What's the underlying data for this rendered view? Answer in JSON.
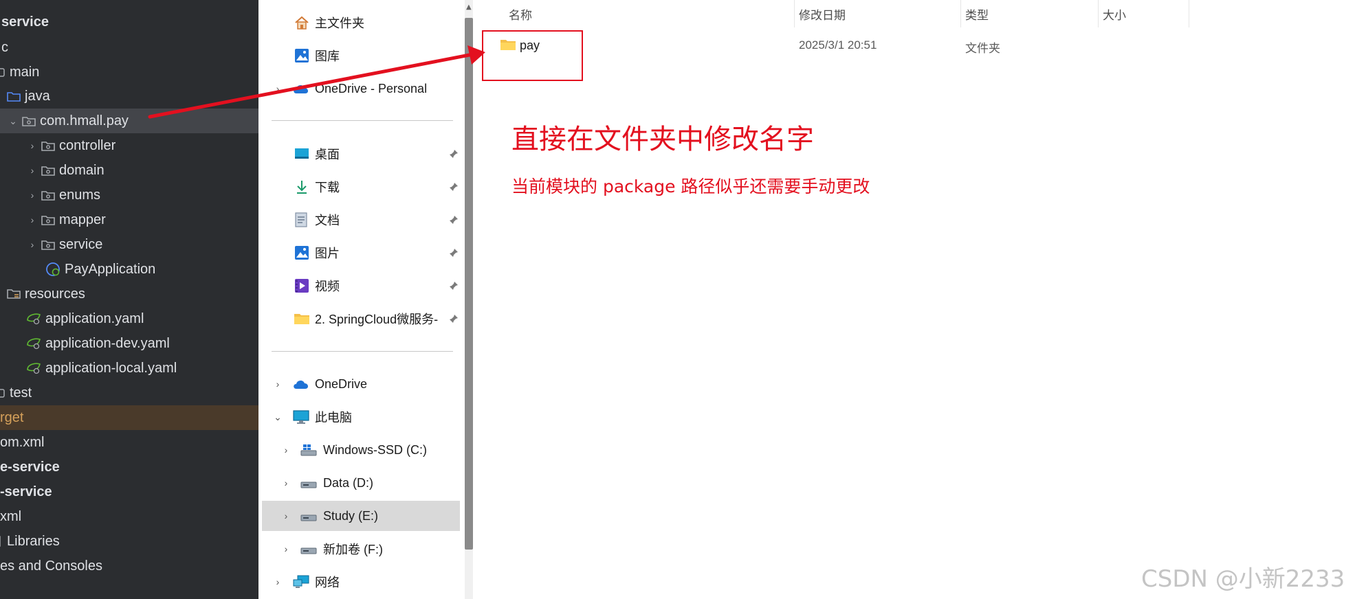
{
  "ide_tree": {
    "rows": [
      {
        "label": "service",
        "bold": true
      },
      {
        "label": "c"
      },
      {
        "label": "main"
      },
      {
        "label": "java"
      },
      {
        "label": "com.hmall.pay"
      },
      {
        "label": "controller"
      },
      {
        "label": "domain"
      },
      {
        "label": "enums"
      },
      {
        "label": "mapper"
      },
      {
        "label": "service"
      },
      {
        "label": "PayApplication"
      },
      {
        "label": "resources"
      },
      {
        "label": "application.yaml"
      },
      {
        "label": "application-dev.yaml"
      },
      {
        "label": "application-local.yaml"
      },
      {
        "label": "test"
      },
      {
        "label": "rget"
      },
      {
        "label": "om.xml"
      },
      {
        "label": "e-service",
        "bold": true
      },
      {
        "label": "-service",
        "bold": true
      },
      {
        "label": "xml"
      },
      {
        "label": "Libraries"
      },
      {
        "label": "es and Consoles"
      }
    ]
  },
  "explorer_nav": {
    "quick": [
      {
        "label": "主文件夹",
        "icon": "home-icon"
      },
      {
        "label": "图库",
        "icon": "gallery-icon"
      },
      {
        "label": "OneDrive - Personal",
        "icon": "cloud-icon"
      }
    ],
    "pinned": [
      {
        "label": "桌面",
        "icon": "desktop-icon"
      },
      {
        "label": "下载",
        "icon": "download-icon"
      },
      {
        "label": "文档",
        "icon": "document-icon"
      },
      {
        "label": "图片",
        "icon": "picture-icon"
      },
      {
        "label": "视频",
        "icon": "video-icon"
      },
      {
        "label": "2. SpringCloud微服务-",
        "icon": "folder-icon"
      }
    ],
    "locations": [
      {
        "label": "OneDrive",
        "icon": "cloud-icon"
      },
      {
        "label": "此电脑",
        "icon": "computer-icon"
      },
      {
        "label": "Windows-SSD (C:)",
        "icon": "drive-icon"
      },
      {
        "label": "Data (D:)",
        "icon": "drive-icon"
      },
      {
        "label": "Study (E:)",
        "icon": "drive-icon",
        "selected": true
      },
      {
        "label": "新加卷 (F:)",
        "icon": "drive-icon"
      },
      {
        "label": "网络",
        "icon": "network-icon"
      }
    ]
  },
  "file_list": {
    "columns": {
      "name": "名称",
      "modified": "修改日期",
      "type": "类型",
      "size": "大小"
    },
    "rows": [
      {
        "name": "pay",
        "modified": "2025/3/1 20:51",
        "type": "文件夹",
        "size": ""
      }
    ]
  },
  "annotation": {
    "title": "直接在文件夹中修改名字",
    "subtitle": "当前模块的 package 路径似乎还需要手动更改",
    "color": "#e3101f"
  },
  "watermark": "CSDN @小新2233",
  "colors": {
    "ide_bg": "#2b2d30",
    "ide_selected": "#43454a",
    "nav_selected": "#d9d9d9",
    "folder_yellow": "#f5c04a",
    "annotation_red": "#e3101f"
  }
}
